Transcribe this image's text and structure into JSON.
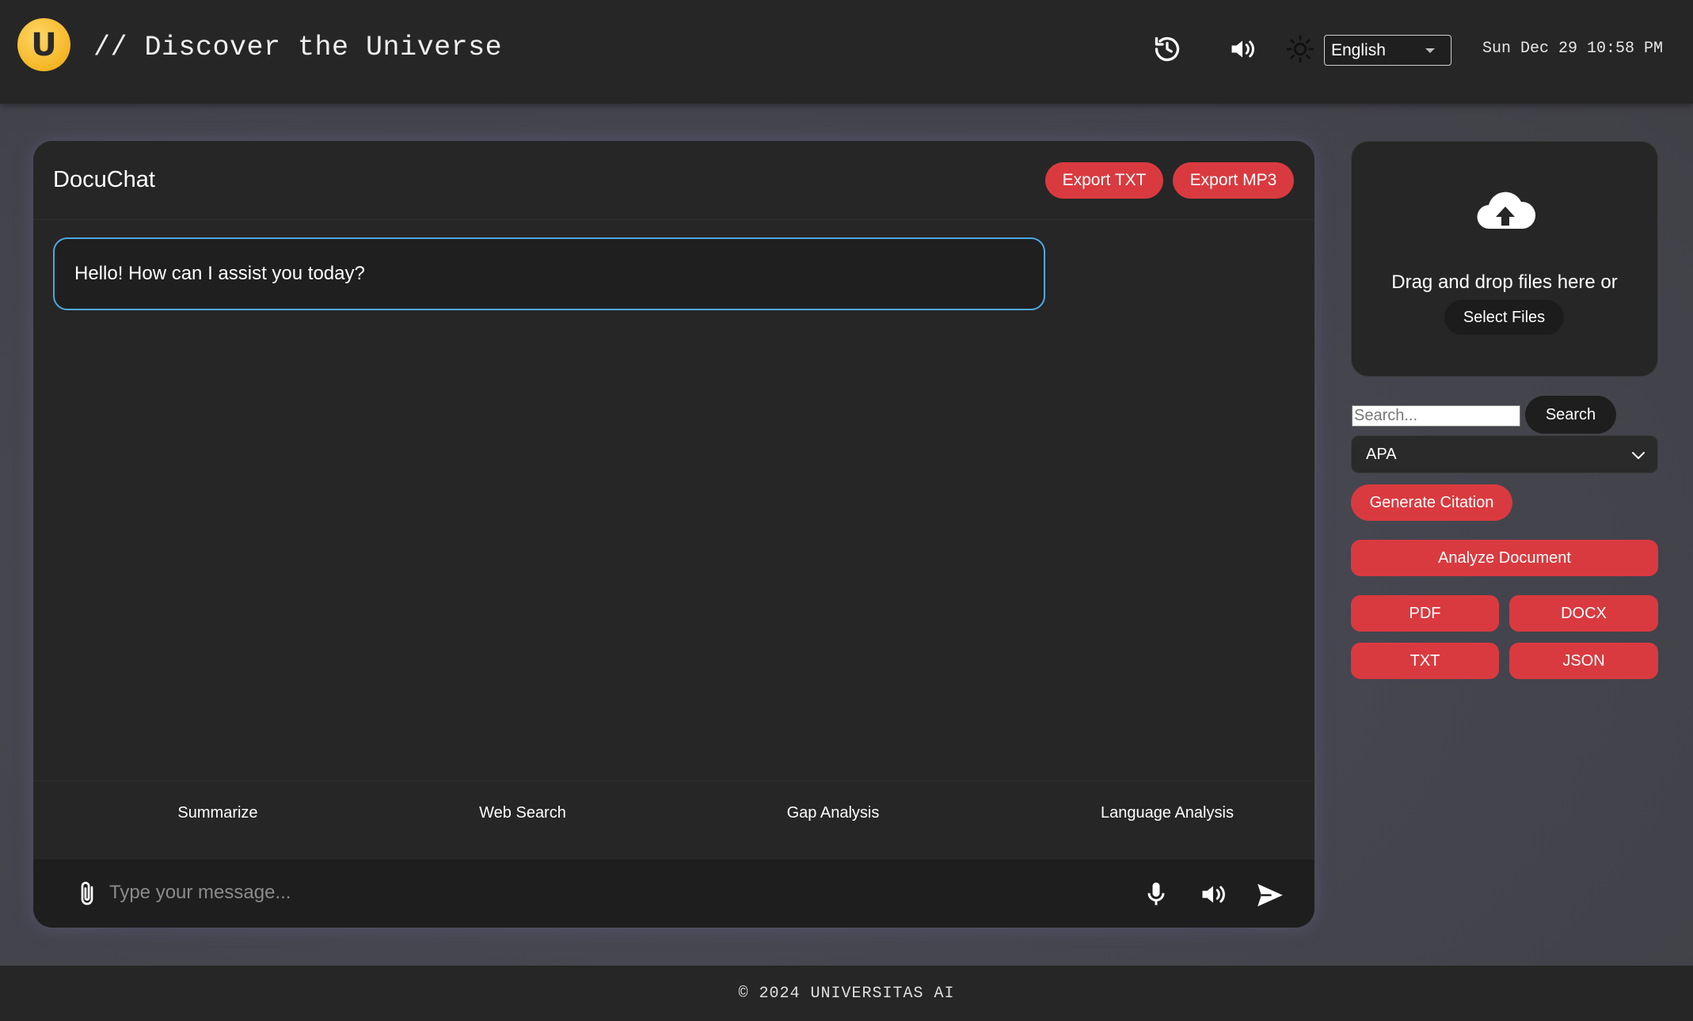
{
  "header": {
    "logo_letter": "U",
    "title": "// Discover the Universe",
    "icons": [
      "history-icon",
      "volume-icon",
      "theme-sun-icon"
    ],
    "language": {
      "selected": "English"
    },
    "datetime": "Sun Dec 29 10:58 PM"
  },
  "chat": {
    "title": "DocuChat",
    "export_txt": "Export TXT",
    "export_mp3": "Export MP3",
    "messages": [
      {
        "role": "assistant",
        "text": "Hello! How can I assist you today?"
      }
    ],
    "quick_actions": [
      "Summarize",
      "Web Search",
      "Gap Analysis",
      "Language Analysis"
    ],
    "input": {
      "placeholder": "Type your message...",
      "icons": [
        "attach-icon",
        "microphone-icon",
        "speaker-icon",
        "send-icon"
      ]
    }
  },
  "sidebar": {
    "upload": {
      "text": "Drag and drop files here or",
      "button": "Select Files",
      "icon": "cloud-upload-icon"
    },
    "search": {
      "placeholder": "Search...",
      "button": "Search"
    },
    "citation": {
      "style_selected": "APA",
      "generate_button": "Generate Citation"
    },
    "analyze_button": "Analyze Document",
    "formats": [
      "PDF",
      "DOCX",
      "TXT",
      "JSON"
    ]
  },
  "footer": {
    "text": "© 2024 UNIVERSITAS AI"
  },
  "colors": {
    "accent_red": "#d93a3f",
    "message_border": "#4fa8e0",
    "logo_gold": "#f5b625",
    "panel_bg": "#262626"
  }
}
